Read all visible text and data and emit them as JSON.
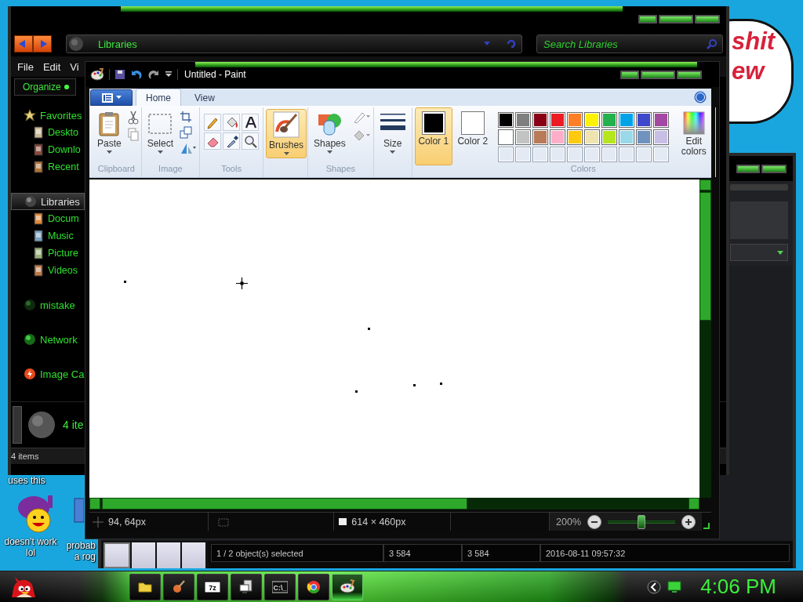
{
  "desktop": {
    "bubble": [
      "shit",
      "ew"
    ],
    "icons": [
      {
        "lines": [
          "uses this"
        ]
      },
      {
        "lines": [
          "doesn't work",
          "lol"
        ]
      },
      {
        "lines": [
          "probab",
          "a rog"
        ]
      }
    ]
  },
  "explorer": {
    "address": "Libraries",
    "search_placeholder": "Search Libraries",
    "menu": [
      "File",
      "Edit",
      "Vi"
    ],
    "organize": "Organize",
    "nav": [
      {
        "label": "Favorites",
        "selected": false,
        "children": [
          {
            "label": "Deskto",
            "selected": false
          },
          {
            "label": "Downlo",
            "selected": false
          },
          {
            "label": "Recent",
            "selected": false
          }
        ]
      },
      {
        "label": "Libraries",
        "selected": true,
        "children": [
          {
            "label": "Docum",
            "selected": false
          },
          {
            "label": "Music",
            "selected": false
          },
          {
            "label": "Picture",
            "selected": false
          },
          {
            "label": "Videos",
            "selected": false
          }
        ]
      },
      {
        "label": "mistake",
        "selected": false
      },
      {
        "label": "Network",
        "selected": false
      },
      {
        "label": "Image Ca",
        "selected": false
      }
    ],
    "details": "4 ite",
    "status": "4 items"
  },
  "back_window": {
    "status": [
      "1 / 2 object(s) selected",
      "3 584",
      "3 584",
      "2016-08-11 09:57:32"
    ]
  },
  "paint": {
    "title": "Untitled - Paint",
    "tabs": [
      {
        "label": "Home",
        "selected": true
      },
      {
        "label": "View",
        "selected": false
      }
    ],
    "paste": "Paste",
    "clipboard_label": "Clipboard",
    "select": "Select",
    "image_label": "Image",
    "tools_label": "Tools",
    "tools": [
      {
        "selected": false
      },
      {
        "selected": false
      },
      {
        "selected": false
      },
      {
        "selected": false
      },
      {
        "selected": false
      },
      {
        "selected": false
      }
    ],
    "brushes": {
      "label": "Brushes",
      "selected": true
    },
    "shapes": "Shapes",
    "shapes_label": "Shapes",
    "size": "Size",
    "color1": {
      "label": "Color 1",
      "color": "#000000",
      "selected": true
    },
    "color2": {
      "label": "Color 2",
      "color": "#ffffff",
      "selected": false
    },
    "palette": [
      [
        {
          "kind": "color",
          "color": "#000000"
        },
        {
          "kind": "color",
          "color": "#7f7f7f"
        },
        {
          "kind": "color",
          "color": "#880015"
        },
        {
          "kind": "color",
          "color": "#ed1c24"
        },
        {
          "kind": "color",
          "color": "#ff7f27"
        },
        {
          "kind": "color",
          "color": "#fff200"
        },
        {
          "kind": "color",
          "color": "#22b14c"
        },
        {
          "kind": "color",
          "color": "#00a2e8"
        },
        {
          "kind": "color",
          "color": "#3f48cc"
        },
        {
          "kind": "color",
          "color": "#a349a4"
        }
      ],
      [
        {
          "kind": "color",
          "color": "#ffffff"
        },
        {
          "kind": "color",
          "color": "#c3c3c3"
        },
        {
          "kind": "color",
          "color": "#b97a57"
        },
        {
          "kind": "color",
          "color": "#ffaec9"
        },
        {
          "kind": "color",
          "color": "#ffc90e"
        },
        {
          "kind": "color",
          "color": "#efe4b0"
        },
        {
          "kind": "color",
          "color": "#b5e61d"
        },
        {
          "kind": "color",
          "color": "#99d9ea"
        },
        {
          "kind": "color",
          "color": "#7092be"
        },
        {
          "kind": "color",
          "color": "#c8bfe7"
        }
      ],
      [
        {
          "kind": "empty"
        },
        {
          "kind": "empty"
        },
        {
          "kind": "empty"
        },
        {
          "kind": "empty"
        },
        {
          "kind": "empty"
        },
        {
          "kind": "empty"
        },
        {
          "kind": "empty"
        },
        {
          "kind": "empty"
        },
        {
          "kind": "empty"
        },
        {
          "kind": "empty"
        }
      ]
    ],
    "edit_colors": "Edit colors",
    "colors_label": "Colors",
    "status": {
      "cursor": "94, 64px",
      "canvas_size": "614 × 460px",
      "zoom": "200%"
    },
    "zoom_slider": {
      "level": 0.5
    }
  },
  "taskbar": {
    "buttons": [
      {
        "selected": false
      },
      {
        "selected": false
      },
      {
        "selected": false,
        "icon_text": "7z"
      },
      {
        "selected": false
      },
      {
        "selected": false,
        "icon_text": "C:\\_"
      },
      {
        "selected": false
      },
      {
        "selected": true
      }
    ],
    "clock": "4:06 PM"
  }
}
